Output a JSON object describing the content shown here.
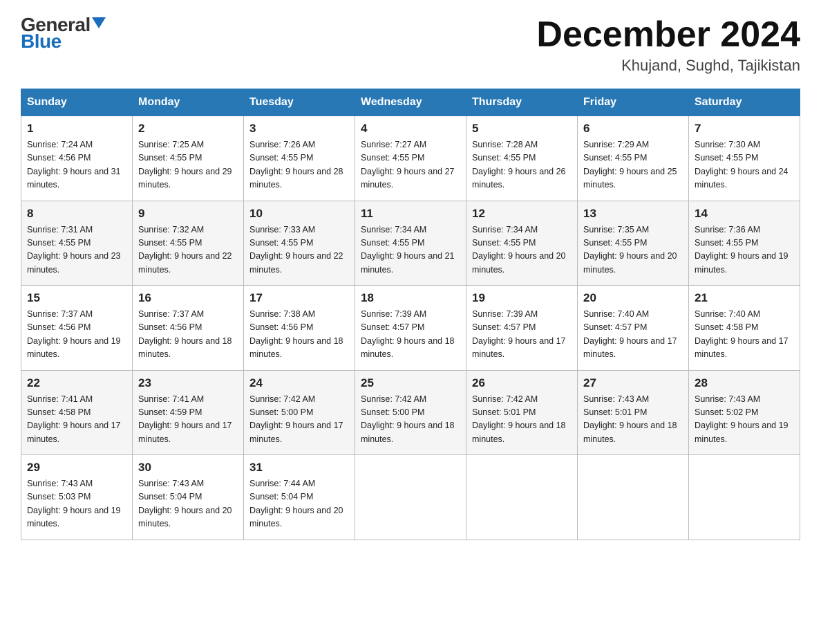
{
  "header": {
    "logo_general": "General",
    "logo_blue": "Blue",
    "month_title": "December 2024",
    "location": "Khujand, Sughd, Tajikistan"
  },
  "weekdays": [
    "Sunday",
    "Monday",
    "Tuesday",
    "Wednesday",
    "Thursday",
    "Friday",
    "Saturday"
  ],
  "weeks": [
    [
      {
        "day": "1",
        "sunrise": "7:24 AM",
        "sunset": "4:56 PM",
        "daylight": "9 hours and 31 minutes."
      },
      {
        "day": "2",
        "sunrise": "7:25 AM",
        "sunset": "4:55 PM",
        "daylight": "9 hours and 29 minutes."
      },
      {
        "day": "3",
        "sunrise": "7:26 AM",
        "sunset": "4:55 PM",
        "daylight": "9 hours and 28 minutes."
      },
      {
        "day": "4",
        "sunrise": "7:27 AM",
        "sunset": "4:55 PM",
        "daylight": "9 hours and 27 minutes."
      },
      {
        "day": "5",
        "sunrise": "7:28 AM",
        "sunset": "4:55 PM",
        "daylight": "9 hours and 26 minutes."
      },
      {
        "day": "6",
        "sunrise": "7:29 AM",
        "sunset": "4:55 PM",
        "daylight": "9 hours and 25 minutes."
      },
      {
        "day": "7",
        "sunrise": "7:30 AM",
        "sunset": "4:55 PM",
        "daylight": "9 hours and 24 minutes."
      }
    ],
    [
      {
        "day": "8",
        "sunrise": "7:31 AM",
        "sunset": "4:55 PM",
        "daylight": "9 hours and 23 minutes."
      },
      {
        "day": "9",
        "sunrise": "7:32 AM",
        "sunset": "4:55 PM",
        "daylight": "9 hours and 22 minutes."
      },
      {
        "day": "10",
        "sunrise": "7:33 AM",
        "sunset": "4:55 PM",
        "daylight": "9 hours and 22 minutes."
      },
      {
        "day": "11",
        "sunrise": "7:34 AM",
        "sunset": "4:55 PM",
        "daylight": "9 hours and 21 minutes."
      },
      {
        "day": "12",
        "sunrise": "7:34 AM",
        "sunset": "4:55 PM",
        "daylight": "9 hours and 20 minutes."
      },
      {
        "day": "13",
        "sunrise": "7:35 AM",
        "sunset": "4:55 PM",
        "daylight": "9 hours and 20 minutes."
      },
      {
        "day": "14",
        "sunrise": "7:36 AM",
        "sunset": "4:55 PM",
        "daylight": "9 hours and 19 minutes."
      }
    ],
    [
      {
        "day": "15",
        "sunrise": "7:37 AM",
        "sunset": "4:56 PM",
        "daylight": "9 hours and 19 minutes."
      },
      {
        "day": "16",
        "sunrise": "7:37 AM",
        "sunset": "4:56 PM",
        "daylight": "9 hours and 18 minutes."
      },
      {
        "day": "17",
        "sunrise": "7:38 AM",
        "sunset": "4:56 PM",
        "daylight": "9 hours and 18 minutes."
      },
      {
        "day": "18",
        "sunrise": "7:39 AM",
        "sunset": "4:57 PM",
        "daylight": "9 hours and 18 minutes."
      },
      {
        "day": "19",
        "sunrise": "7:39 AM",
        "sunset": "4:57 PM",
        "daylight": "9 hours and 17 minutes."
      },
      {
        "day": "20",
        "sunrise": "7:40 AM",
        "sunset": "4:57 PM",
        "daylight": "9 hours and 17 minutes."
      },
      {
        "day": "21",
        "sunrise": "7:40 AM",
        "sunset": "4:58 PM",
        "daylight": "9 hours and 17 minutes."
      }
    ],
    [
      {
        "day": "22",
        "sunrise": "7:41 AM",
        "sunset": "4:58 PM",
        "daylight": "9 hours and 17 minutes."
      },
      {
        "day": "23",
        "sunrise": "7:41 AM",
        "sunset": "4:59 PM",
        "daylight": "9 hours and 17 minutes."
      },
      {
        "day": "24",
        "sunrise": "7:42 AM",
        "sunset": "5:00 PM",
        "daylight": "9 hours and 17 minutes."
      },
      {
        "day": "25",
        "sunrise": "7:42 AM",
        "sunset": "5:00 PM",
        "daylight": "9 hours and 18 minutes."
      },
      {
        "day": "26",
        "sunrise": "7:42 AM",
        "sunset": "5:01 PM",
        "daylight": "9 hours and 18 minutes."
      },
      {
        "day": "27",
        "sunrise": "7:43 AM",
        "sunset": "5:01 PM",
        "daylight": "9 hours and 18 minutes."
      },
      {
        "day": "28",
        "sunrise": "7:43 AM",
        "sunset": "5:02 PM",
        "daylight": "9 hours and 19 minutes."
      }
    ],
    [
      {
        "day": "29",
        "sunrise": "7:43 AM",
        "sunset": "5:03 PM",
        "daylight": "9 hours and 19 minutes."
      },
      {
        "day": "30",
        "sunrise": "7:43 AM",
        "sunset": "5:04 PM",
        "daylight": "9 hours and 20 minutes."
      },
      {
        "day": "31",
        "sunrise": "7:44 AM",
        "sunset": "5:04 PM",
        "daylight": "9 hours and 20 minutes."
      },
      null,
      null,
      null,
      null
    ]
  ],
  "labels": {
    "sunrise": "Sunrise:",
    "sunset": "Sunset:",
    "daylight": "Daylight:"
  }
}
